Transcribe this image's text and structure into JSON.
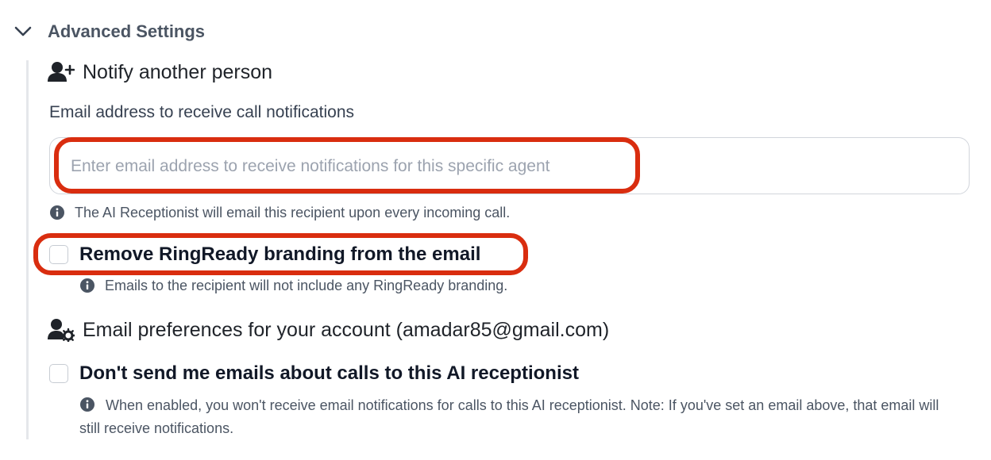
{
  "advanced_settings": {
    "title": "Advanced Settings",
    "toggle_icon": "chevron-down-icon"
  },
  "notify_section": {
    "icon": "user-plus-icon",
    "title": "Notify another person",
    "email_label": "Email address to receive call notifications",
    "email_value": "",
    "email_placeholder": "Enter email address to receive notifications for this specific agent",
    "email_hint": "The AI Receptionist will email this recipient upon every incoming call.",
    "remove_branding": {
      "label": "Remove RingReady branding from the email",
      "checked": false,
      "hint": "Emails to the recipient will not include any RingReady branding."
    }
  },
  "account_prefs": {
    "icon": "user-gear-icon",
    "title": "Email preferences for your account (amadar85@gmail.com)",
    "dont_send": {
      "label": "Don't send me emails about calls to this AI receptionist",
      "checked": false,
      "hint": "When enabled, you won't receive email notifications for calls to this AI receptionist. Note: If you've set an email above, that email will still receive notifications."
    }
  },
  "colors": {
    "highlight": "#d92d0f",
    "text_muted": "#4b5563",
    "border": "#d1d5db"
  }
}
